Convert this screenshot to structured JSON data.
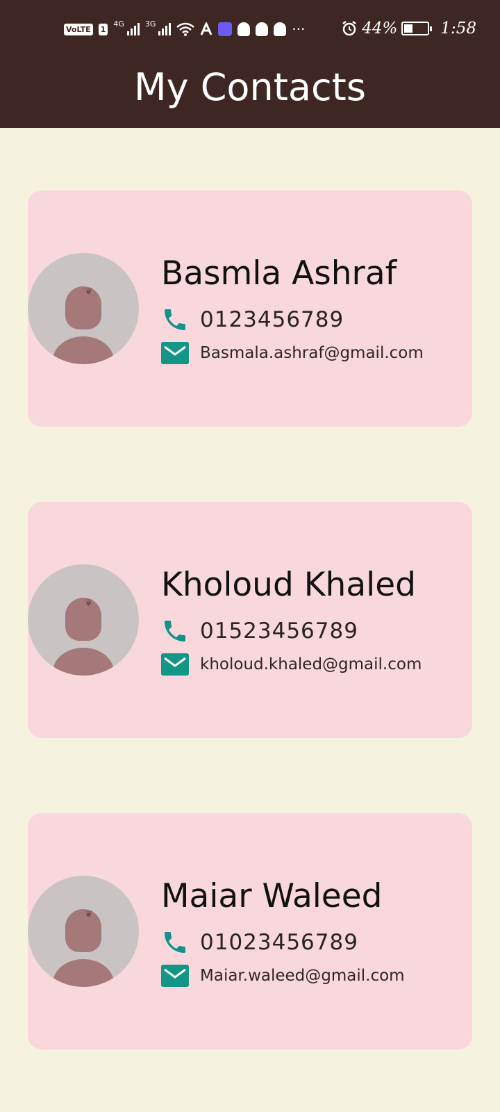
{
  "status_bar": {
    "volte_label": "VoLTE",
    "sim_label": "1",
    "net1_label": "4G",
    "net2_label": "3G",
    "more_label": "···",
    "battery_label": "44%",
    "battery_level": 0.44,
    "time": "1:58"
  },
  "header": {
    "title": "My Contacts"
  },
  "contacts": [
    {
      "name": "Basmla Ashraf",
      "phone": "0123456789",
      "email": "Basmala.ashraf@gmail.com"
    },
    {
      "name": "Kholoud Khaled",
      "phone": "01523456789",
      "email": "kholoud.khaled@gmail.com"
    },
    {
      "name": "Maiar Waleed",
      "phone": "01023456789",
      "email": "Maiar.waleed@gmail.com"
    }
  ],
  "icons": {
    "phone": "phone-icon",
    "email": "mail-icon",
    "avatar": "avatar-placeholder"
  },
  "colors": {
    "appbar": "#3e2723",
    "background": "#f5f3de",
    "card": "#f8d8dc",
    "icon_accent": "#14918a"
  }
}
